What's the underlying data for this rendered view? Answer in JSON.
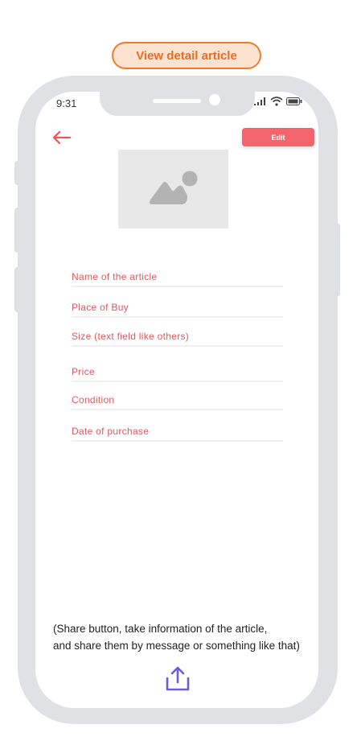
{
  "header": {
    "title": "View detail article"
  },
  "status_bar": {
    "time": "9:31"
  },
  "toolbar": {
    "back_icon": "arrow-left-icon",
    "edit_label": "Edit"
  },
  "article": {
    "image_icon": "image-placeholder-icon",
    "fields": [
      "Name of the article",
      "Place of Buy",
      "Size (text field like others)",
      "Price",
      "Condition",
      "Date of purchase"
    ]
  },
  "note": {
    "line1": "(Share button, take information of the article,",
    "line2": "and share them by message or something like that)"
  },
  "share": {
    "icon": "share-icon"
  },
  "colors": {
    "accent": "#f0535a",
    "share": "#6b5ce0",
    "frame": "#dfe1e5",
    "pill_border": "#f07b2e"
  }
}
